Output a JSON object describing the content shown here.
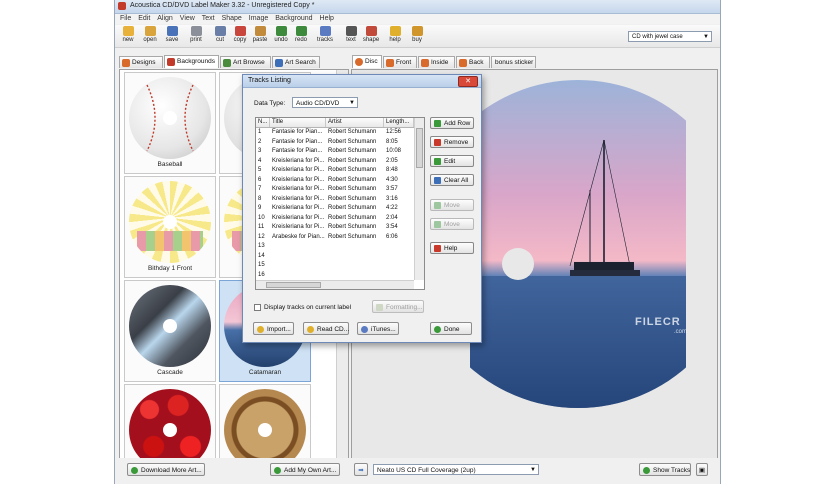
{
  "window": {
    "title": "Acoustica CD/DVD Label Maker 3.32 - Unregistered Copy *"
  },
  "menu": [
    "File",
    "Edit",
    "Align",
    "View",
    "Text",
    "Shape",
    "Image",
    "Background",
    "Help"
  ],
  "toolbar": {
    "buttons": [
      {
        "label": "new",
        "icon": "new-icon",
        "color": "#e8b23a"
      },
      {
        "label": "open",
        "icon": "open-folder-icon",
        "color": "#d9a43c"
      },
      {
        "label": "save",
        "icon": "save-disk-icon",
        "color": "#4a72b8"
      },
      {
        "label": "print",
        "icon": "printer-icon",
        "color": "#8a8f99"
      },
      {
        "label": "cut",
        "icon": "scissors-icon",
        "color": "#6a7fa8"
      },
      {
        "label": "copy",
        "icon": "copy-icon",
        "color": "#c9463c"
      },
      {
        "label": "paste",
        "icon": "paste-icon",
        "color": "#c28b3c"
      },
      {
        "label": "undo",
        "icon": "undo-icon",
        "color": "#3d8a3d"
      },
      {
        "label": "redo",
        "icon": "redo-icon",
        "color": "#3d8a3d"
      },
      {
        "label": "tracks",
        "icon": "tracks-icon",
        "color": "#5a7bc2"
      },
      {
        "label": "text",
        "icon": "text-icon",
        "color": "#555555"
      },
      {
        "label": "shape",
        "icon": "shape-icon",
        "color": "#c24a3a"
      },
      {
        "label": "help",
        "icon": "help-icon",
        "color": "#e0b02c"
      },
      {
        "label": "buy",
        "icon": "buy-icon",
        "color": "#d0962c"
      }
    ],
    "label_type": "CD with jewel case"
  },
  "left_tabs": [
    {
      "label": "Designs",
      "icon": "designs-icon",
      "color": "#d86a2c"
    },
    {
      "label": "Backgrounds",
      "icon": "backgrounds-icon",
      "color": "#c23a2a",
      "active": true
    },
    {
      "label": "Art Browse",
      "icon": "art-browse-icon",
      "color": "#4a8a3d"
    },
    {
      "label": "Art Search",
      "icon": "art-search-icon",
      "color": "#3d6fb8"
    }
  ],
  "right_tabs": [
    {
      "label": "Disc",
      "icon": "disc-icon",
      "color": "#d86a2c",
      "active": true
    },
    {
      "label": "Front",
      "icon": "front-icon",
      "color": "#d86a2c"
    },
    {
      "label": "Inside",
      "icon": "inside-icon",
      "color": "#d86a2c"
    },
    {
      "label": "Back",
      "icon": "back-icon",
      "color": "#d86a2c"
    },
    {
      "label": "bonus sticker",
      "icon": "",
      "color": ""
    }
  ],
  "art_items": [
    {
      "caption": "Baseball",
      "selected": false
    },
    {
      "caption": "",
      "selected": false
    },
    {
      "caption": "Bithday 1 Front",
      "selected": false
    },
    {
      "caption": "",
      "selected": false
    },
    {
      "caption": "Cascade",
      "selected": false
    },
    {
      "caption": "Catamaran",
      "selected": true
    },
    {
      "caption": "",
      "selected": false
    },
    {
      "caption": "",
      "selected": false
    }
  ],
  "bottom": {
    "download_more": "Download More Art...",
    "add_my_own": "Add My Own Art...",
    "printer_label": "Neato US CD Full Coverage (2up)",
    "show_tracks": "Show Tracks"
  },
  "dialog": {
    "title": "Tracks Listing",
    "data_type_label": "Data Type:",
    "data_type_value": "Audio CD/DVD",
    "columns": [
      "N...",
      "Title",
      "Artist",
      "Length..."
    ],
    "tracks": [
      {
        "n": "1",
        "title": "Fantasie for Pian...",
        "artist": "Robert Schumann",
        "length": "12:56"
      },
      {
        "n": "2",
        "title": "Fantasie for Pian...",
        "artist": "Robert Schumann",
        "length": "8:05"
      },
      {
        "n": "3",
        "title": "Fantasie for Pian...",
        "artist": "Robert Schumann",
        "length": "10:08"
      },
      {
        "n": "4",
        "title": "Kreisleriana for Pi...",
        "artist": "Robert Schumann",
        "length": "2:05"
      },
      {
        "n": "5",
        "title": "Kreisleriana for Pi...",
        "artist": "Robert Schumann",
        "length": "8:48"
      },
      {
        "n": "6",
        "title": "Kreisleriana for Pi...",
        "artist": "Robert Schumann",
        "length": "4:30"
      },
      {
        "n": "7",
        "title": "Kreisleriana for Pi...",
        "artist": "Robert Schumann",
        "length": "3:57"
      },
      {
        "n": "8",
        "title": "Kreisleriana for Pi...",
        "artist": "Robert Schumann",
        "length": "3:16"
      },
      {
        "n": "9",
        "title": "Kreisleriana for Pi...",
        "artist": "Robert Schumann",
        "length": "4:22"
      },
      {
        "n": "10",
        "title": "Kreisleriana for Pi...",
        "artist": "Robert Schumann",
        "length": "2:04"
      },
      {
        "n": "11",
        "title": "Kreisleriana for Pi...",
        "artist": "Robert Schumann",
        "length": "3:54"
      },
      {
        "n": "12",
        "title": "Arabeske for Pian...",
        "artist": "Robert Schumann",
        "length": "6:06"
      },
      {
        "n": "13",
        "title": "",
        "artist": "",
        "length": ""
      },
      {
        "n": "14",
        "title": "",
        "artist": "",
        "length": ""
      },
      {
        "n": "15",
        "title": "",
        "artist": "",
        "length": ""
      },
      {
        "n": "16",
        "title": "",
        "artist": "",
        "length": ""
      }
    ],
    "side_buttons": [
      {
        "label": "Add Row",
        "icon": "add-row-icon",
        "color": "#3a9a3a",
        "enabled": true
      },
      {
        "label": "Remove",
        "icon": "remove-icon",
        "color": "#c8392b",
        "enabled": true
      },
      {
        "label": "Edit",
        "icon": "edit-icon",
        "color": "#3a9a3a",
        "enabled": true
      },
      {
        "label": "Clear All",
        "icon": "clear-all-icon",
        "color": "#3d6fb8",
        "enabled": true
      },
      {
        "label": "Move",
        "icon": "move-up-icon",
        "color": "#9fc79f",
        "enabled": false
      },
      {
        "label": "Move",
        "icon": "move-down-icon",
        "color": "#9fc79f",
        "enabled": false
      },
      {
        "label": "Help",
        "icon": "help-icon",
        "color": "#c8392b",
        "enabled": true
      }
    ],
    "display_tracks_label": "Display tracks on current label",
    "display_tracks_checked": false,
    "formatting_label": "Formatting...",
    "footer_buttons": [
      {
        "label": "Import...",
        "icon": "import-icon",
        "color": "#e0b02c"
      },
      {
        "label": "Read CD...",
        "icon": "read-cd-icon",
        "color": "#e0b02c"
      },
      {
        "label": "iTunes...",
        "icon": "itunes-icon",
        "color": "#5a7bc2"
      },
      {
        "label": "Done",
        "icon": "done-icon",
        "color": "#3a9a3a"
      }
    ]
  },
  "watermark": {
    "text": "FILECR",
    "sub": ".com"
  }
}
